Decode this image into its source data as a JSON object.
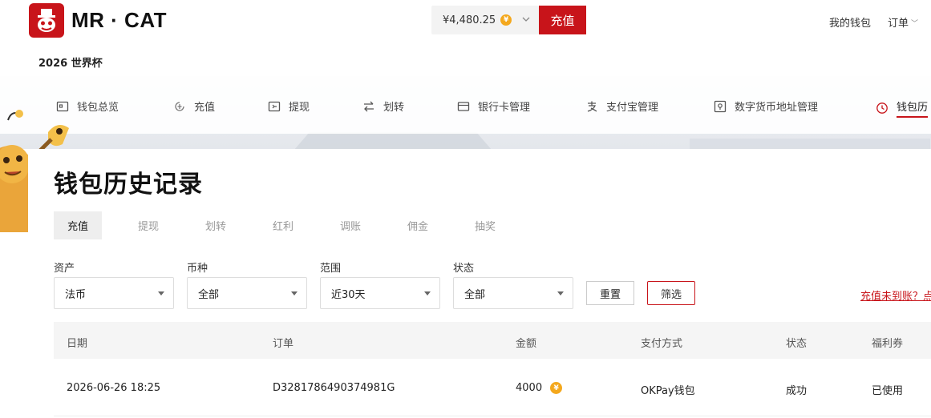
{
  "brand": {
    "name": "MR · CAT",
    "subtitle": "2026 世界杯",
    "color": "#c8141a"
  },
  "header": {
    "balance": "¥4,480.25",
    "currency_icon": "yen-coin-icon",
    "deposit_label": "充值",
    "wallet_link": "我的钱包",
    "orders_link": "订单"
  },
  "nav": {
    "items": [
      {
        "label": "钱包总览",
        "icon": "wallet-icon"
      },
      {
        "label": "充值",
        "icon": "deposit-icon"
      },
      {
        "label": "提现",
        "icon": "withdraw-icon"
      },
      {
        "label": "划转",
        "icon": "transfer-icon"
      },
      {
        "label": "银行卡管理",
        "icon": "bank-card-icon"
      },
      {
        "label": "支付宝管理",
        "icon": "alipay-icon"
      },
      {
        "label": "数字货币地址管理",
        "icon": "address-icon"
      },
      {
        "label": "钱包历",
        "icon": "clock-icon"
      }
    ],
    "active_index": 7
  },
  "page": {
    "title": "钱包历史记录"
  },
  "tabs": [
    "充值",
    "提现",
    "划转",
    "红利",
    "调账",
    "佣金",
    "抽奖"
  ],
  "filters": {
    "asset": {
      "label": "资产",
      "value": "法币"
    },
    "currency": {
      "label": "币种",
      "value": "全部"
    },
    "range": {
      "label": "范围",
      "value": "近30天"
    },
    "status": {
      "label": "状态",
      "value": "全部"
    },
    "reset_label": "重置",
    "filter_label": "筛选",
    "help_link": "充值未到账？点"
  },
  "table": {
    "headers": [
      "日期",
      "订单",
      "金额",
      "支付方式",
      "状态",
      "福利券"
    ],
    "rows": [
      {
        "date": "2026-06-26 18:25",
        "order": "D3281786490374981G",
        "amount": "4000",
        "method": "OKPay钱包",
        "status": "成功",
        "coupon": "已使用"
      }
    ]
  }
}
